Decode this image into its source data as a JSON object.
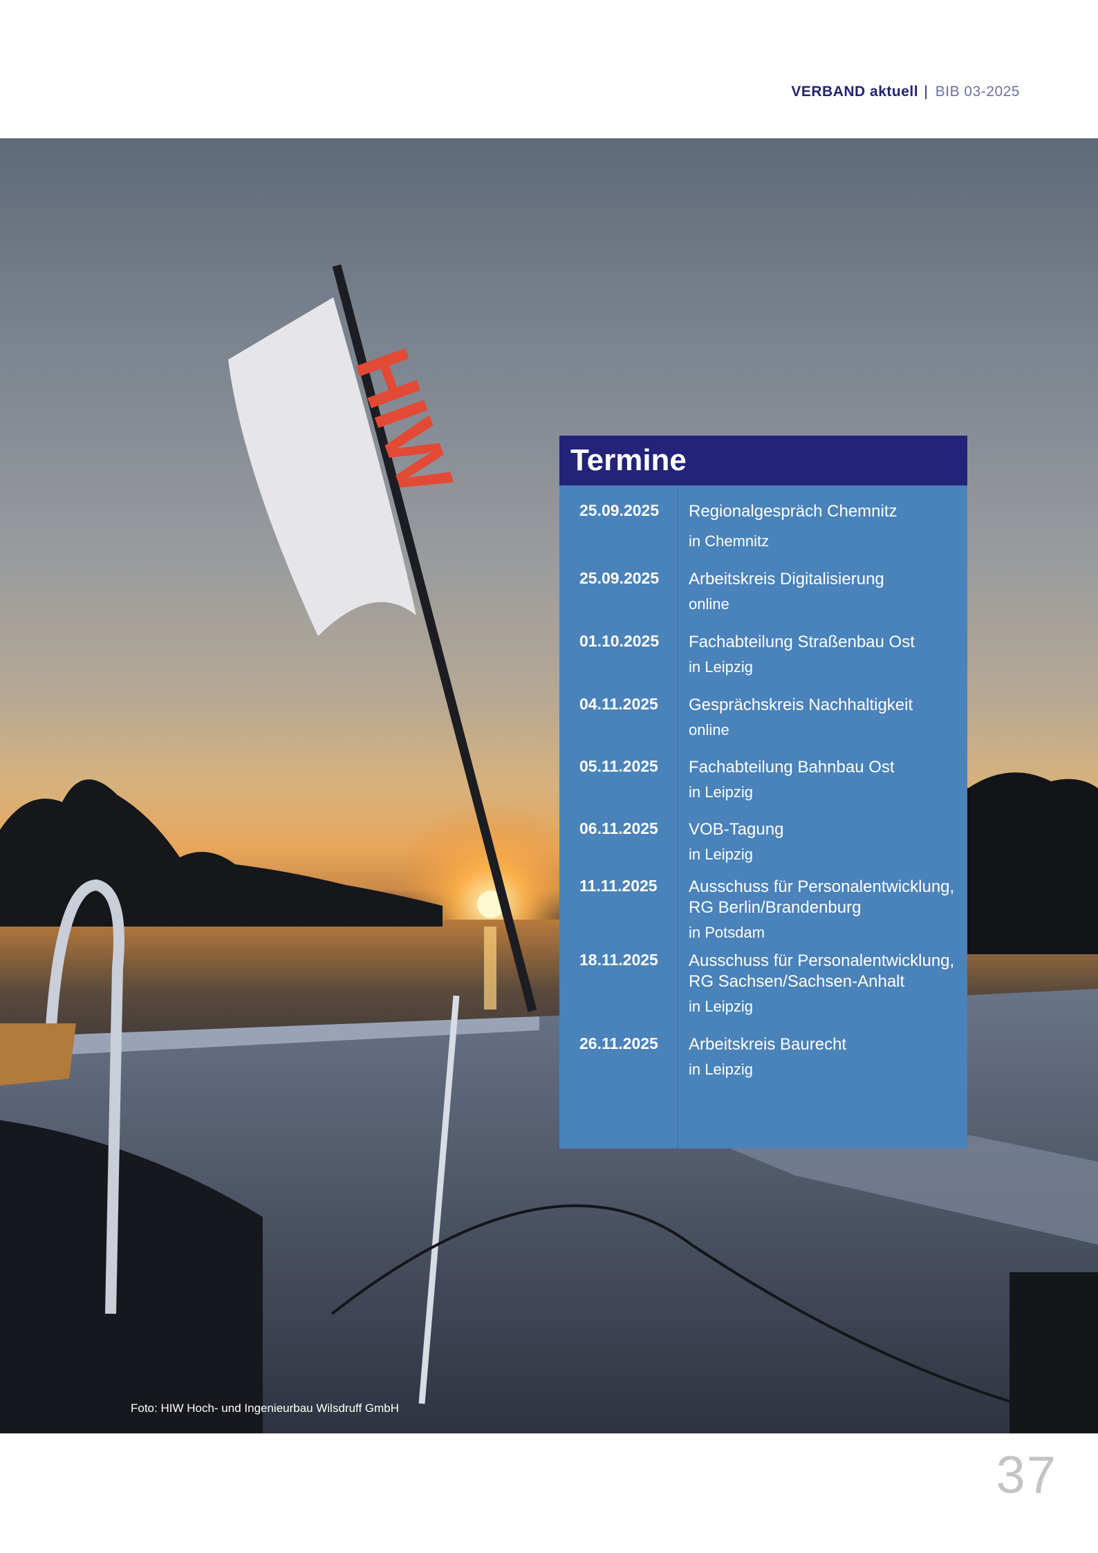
{
  "header": {
    "section": "VERBAND aktuell",
    "separator": "|",
    "issue": "BIB 03-2025"
  },
  "photo": {
    "description_icon": "river-sunset-boat-photo",
    "flag_text": "HIW",
    "credit": "Foto: HIW Hoch- und Ingenieurbau Wilsdruff GmbH"
  },
  "termine": {
    "heading": "Termine",
    "events": [
      {
        "date": "25.09.2025",
        "title": "Regionalgespräch Chemnitz",
        "place": "in Chemnitz"
      },
      {
        "date": "25.09.2025",
        "title": "Arbeitskreis Digitalisierung",
        "place": "online"
      },
      {
        "date": "01.10.2025",
        "title": "Fachabteilung Straßenbau Ost",
        "place": "in Leipzig"
      },
      {
        "date": "04.11.2025",
        "title": "Gesprächskreis Nachhaltigkeit",
        "place": "online"
      },
      {
        "date": "05.11.2025",
        "title": "Fachabteilung Bahnbau Ost",
        "place": "in Leipzig"
      },
      {
        "date": "06.11.2025",
        "title": "VOB-Tagung",
        "place": "in Leipzig"
      },
      {
        "date": "11.11.2025",
        "title": "Ausschuss für Personalentwicklung, RG Berlin/Brandenburg",
        "place": "in Potsdam"
      },
      {
        "date": "18.11.2025",
        "title": "Ausschuss für Personalentwicklung, RG Sachsen/Sachsen-Anhalt",
        "place": "in Leipzig"
      },
      {
        "date": "26.11.2025",
        "title": "Arbeitskreis Baurecht",
        "place": "in Leipzig"
      }
    ]
  },
  "footer": {
    "page_number": "37"
  },
  "colors": {
    "brand_dark": "#23237a",
    "box_blue": "#4a82ba"
  }
}
